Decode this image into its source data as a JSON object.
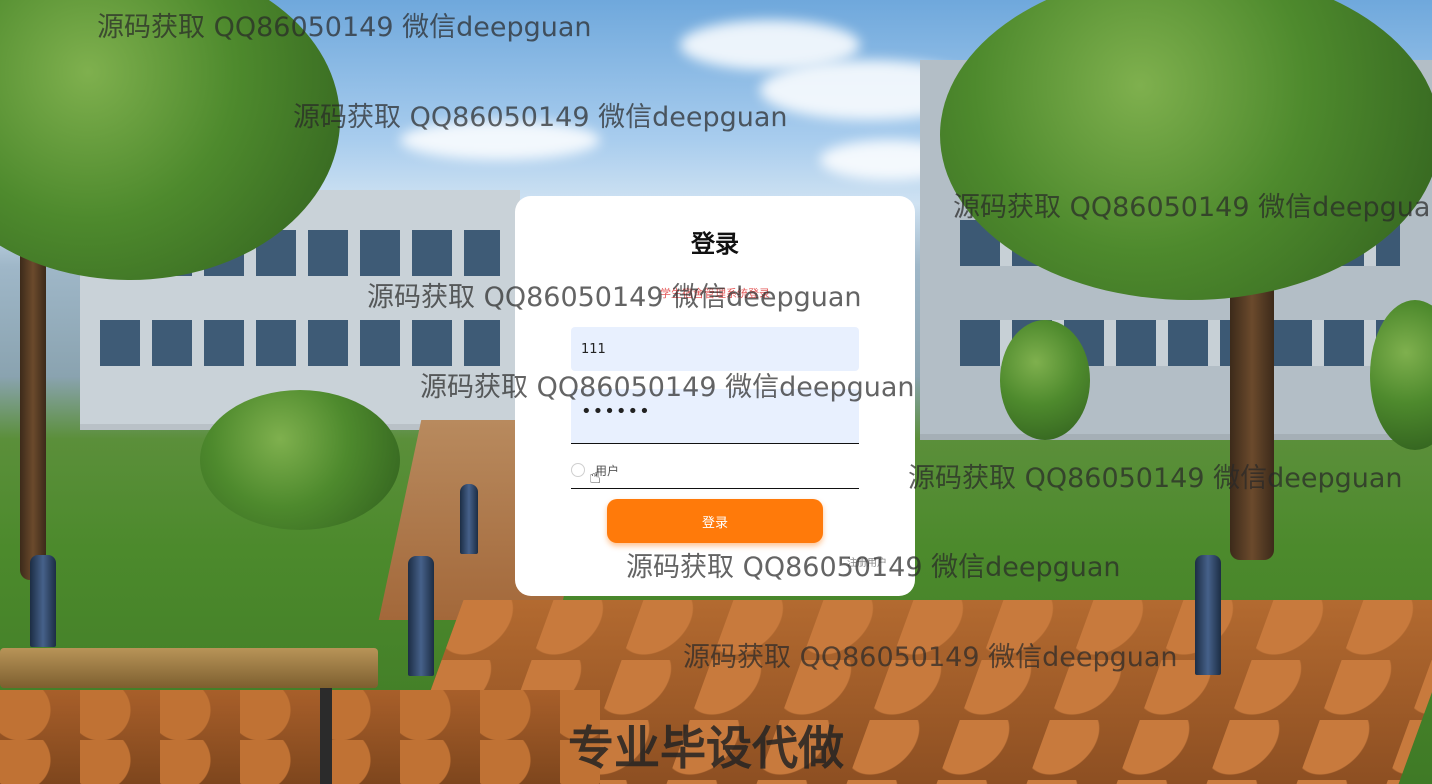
{
  "login": {
    "title": "登录",
    "subtitle": "学生宿舍管理系统登录",
    "username_value": "111",
    "password_value": "••••••",
    "role_label": "用户",
    "submit_label": "登录",
    "register_link": "注册用户"
  },
  "watermarks": [
    "源码获取 QQ86050149 微信deepguan",
    "源码获取 QQ86050149 微信deepguan",
    "源码获取 QQ86050149 微信deepguan",
    "源码获取 QQ86050149 微信deepguan",
    "源码获取 QQ86050149 微信deepguan",
    "源码获取 QQ86050149 微信deepguan",
    "源码获取 QQ86050149 微信deepguan",
    "源码获取 QQ86050149 微信deepguan"
  ],
  "footer_text": "专业毕设代做",
  "icons": {
    "cursor": "hand-pointer-icon"
  },
  "colors": {
    "accent": "#ff7a0a",
    "input_bg": "#e8f0fe"
  }
}
